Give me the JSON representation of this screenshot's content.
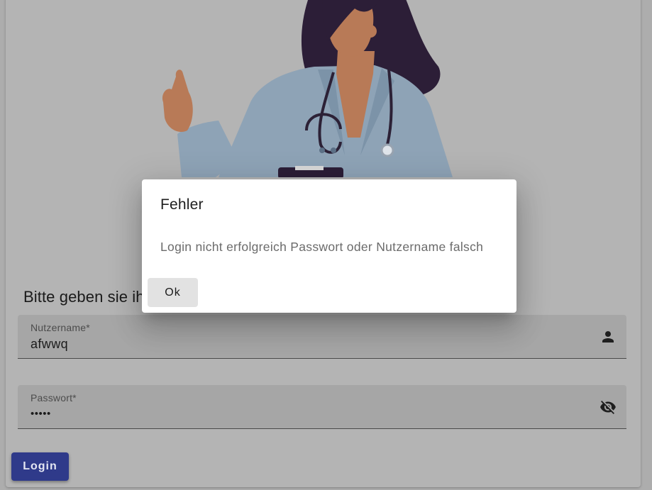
{
  "form": {
    "title": "Bitte geben sie ih",
    "username": {
      "label": "Nutzername*",
      "value": "afwwq",
      "icon": "person-icon"
    },
    "password": {
      "label": "Passwort*",
      "value": "•••••",
      "icon": "visibility-off-icon"
    },
    "login_label": "Login"
  },
  "dialog": {
    "title": "Fehler",
    "message": "Login nicht erfolgreich Passwort oder Nutzername falsch",
    "ok_label": "Ok"
  },
  "colors": {
    "primary": "#2f3a8a",
    "scrim": "#adadad",
    "dialog_bg": "#ffffff"
  }
}
